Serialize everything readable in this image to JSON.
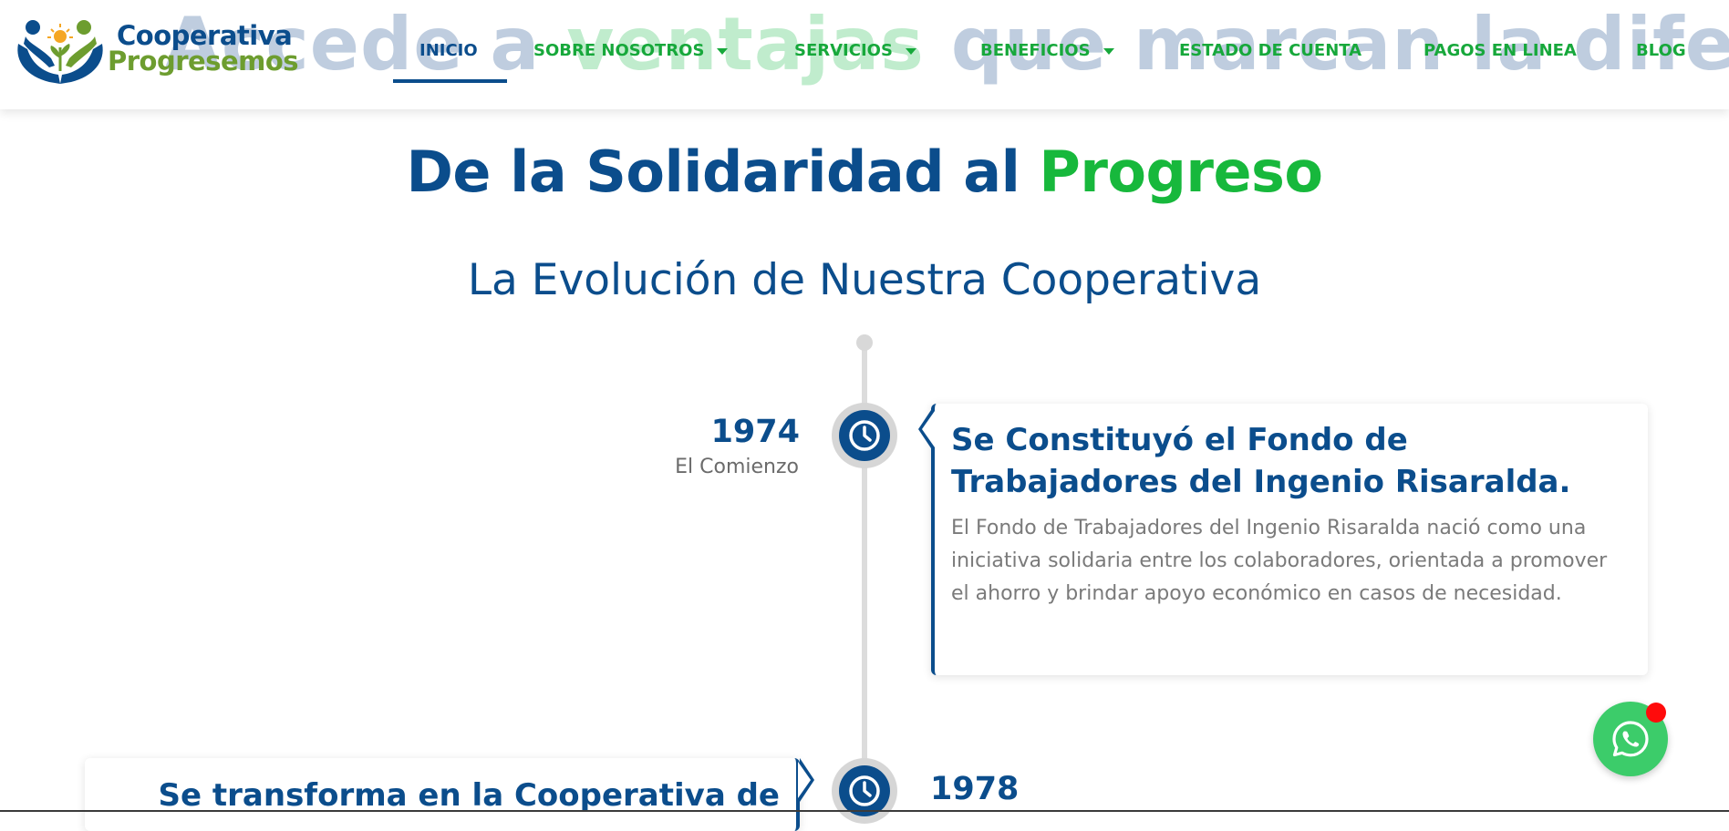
{
  "brand": {
    "name_line1": "Cooperativa",
    "name_line2": "Progresemos"
  },
  "hero_overlay": {
    "part1": "Accede a ",
    "part2": "ventajas",
    "part3": " que marcan la diferencia."
  },
  "nav": {
    "items": [
      {
        "label": "INICIO",
        "active": true,
        "has_dropdown": false
      },
      {
        "label": "SOBRE NOSOTROS",
        "active": false,
        "has_dropdown": true
      },
      {
        "label": "SERVICIOS",
        "active": false,
        "has_dropdown": true
      },
      {
        "label": "BENEFICIOS",
        "active": false,
        "has_dropdown": true
      },
      {
        "label": "ESTADO DE CUENTA",
        "active": false,
        "has_dropdown": false
      },
      {
        "label": "PAGOS EN LINEA",
        "active": false,
        "has_dropdown": false
      },
      {
        "label": "BLOG",
        "active": false,
        "has_dropdown": false
      }
    ]
  },
  "heading": {
    "title_part1": "De la Solidaridad al ",
    "title_part2": "Progreso",
    "subtitle": "La Evolución de Nuestra Cooperativa"
  },
  "timeline": [
    {
      "year": "1974",
      "label": "El Comienzo",
      "title": "Se Constituyó el Fondo de Trabajadores del Ingenio Risaralda.",
      "text": "El Fondo de Trabajadores del Ingenio Risaralda nació como una iniciativa solidaria entre los colaboradores, orientada a promover el ahorro y brindar apoyo económico en casos de necesidad.",
      "icon": "clock-icon"
    },
    {
      "year": "1978",
      "label": "",
      "title": "Se transforma en la Cooperativa de",
      "text": "",
      "icon": "clock-icon"
    }
  ],
  "colors": {
    "primary_blue": "#0b4d8c",
    "primary_green": "#17b83c",
    "logo_green": "#6d9d2f",
    "whatsapp_green": "#3ccc6a",
    "notification_red": "#ff0b0b"
  },
  "floating": {
    "icon": "whatsapp-icon",
    "badge": "notification-dot"
  }
}
